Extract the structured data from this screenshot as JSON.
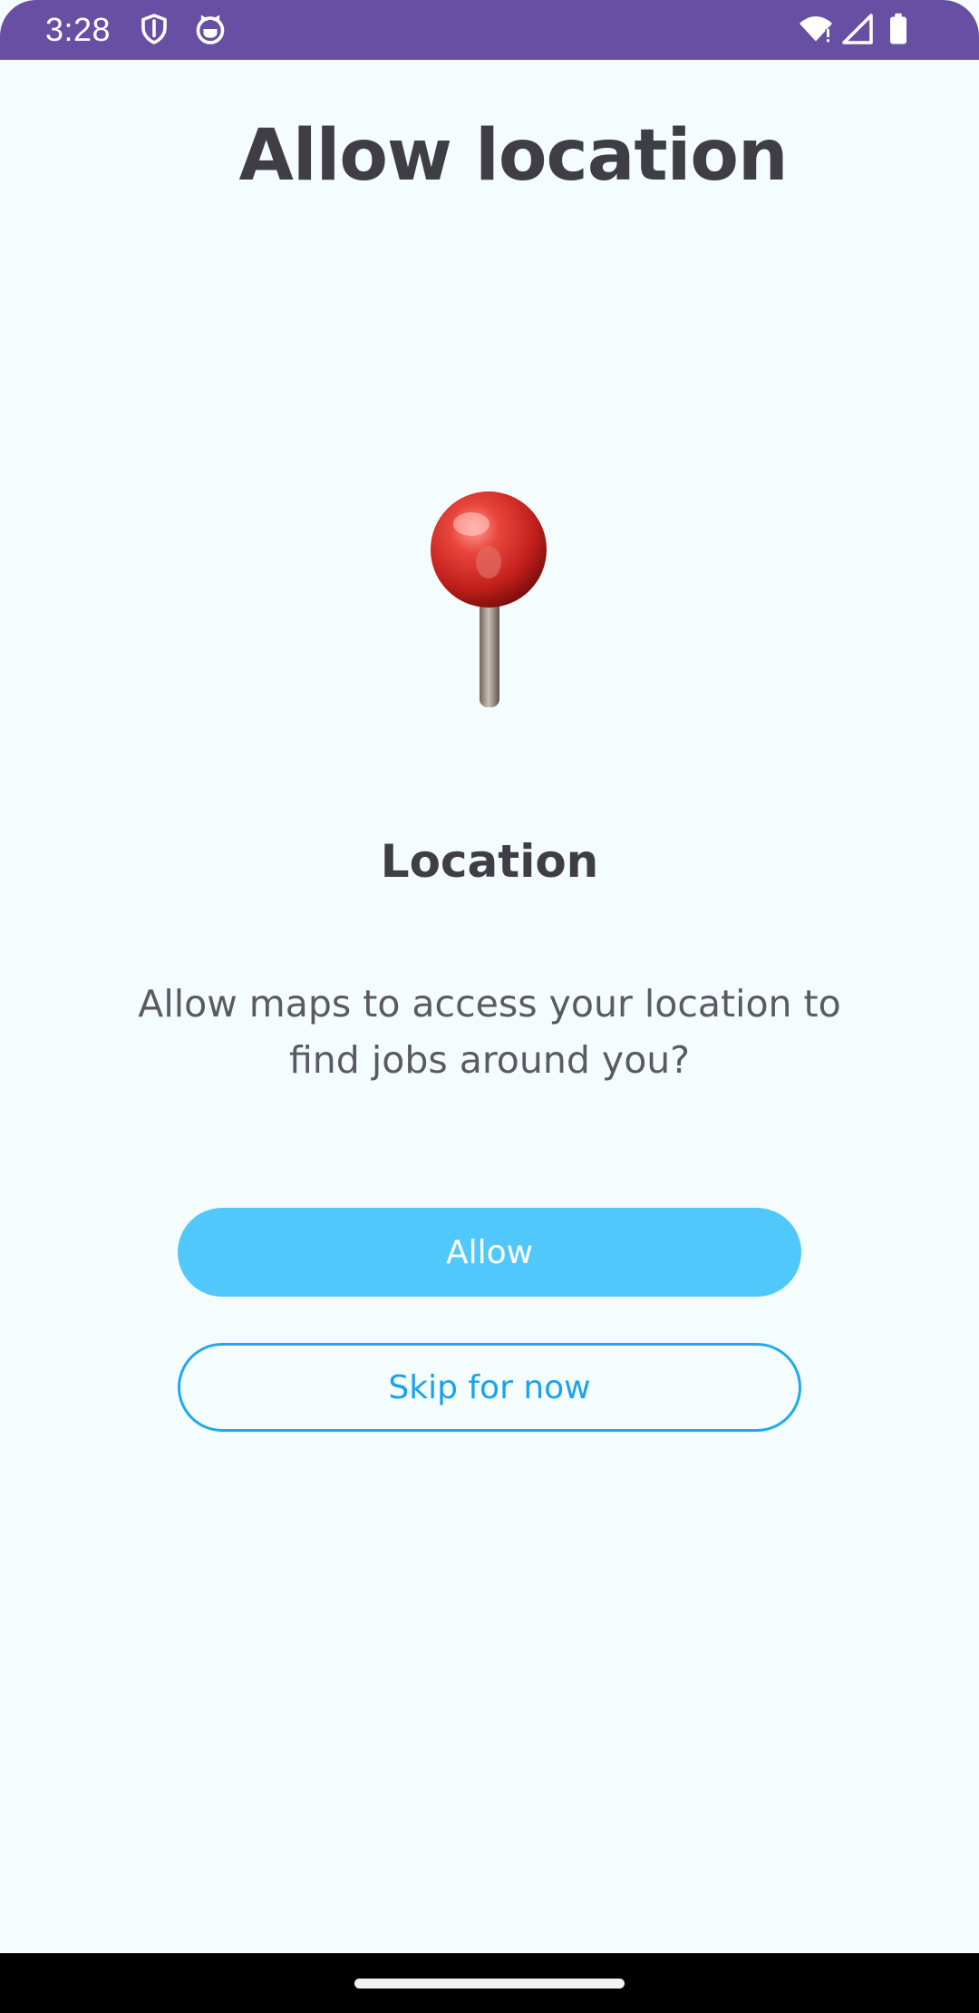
{
  "status_bar": {
    "time": "3:28",
    "left_icons": [
      "shield-icon",
      "cat-face-icon"
    ],
    "right_icons": [
      "wifi-icon",
      "signal-icon",
      "battery-icon"
    ],
    "background": "#6750a4"
  },
  "page": {
    "title": "Allow location",
    "illustration": "red-pushpin",
    "section_title": "Location",
    "description": "Allow maps to access your location to find jobs around you?"
  },
  "actions": {
    "allow_label": "Allow",
    "skip_label": "Skip for now"
  },
  "colors": {
    "background": "#f5fcfe",
    "primary": "#51c8fb",
    "outline": "#1faaf0",
    "heading": "#3f3e45",
    "body_text": "#5b5a60"
  }
}
